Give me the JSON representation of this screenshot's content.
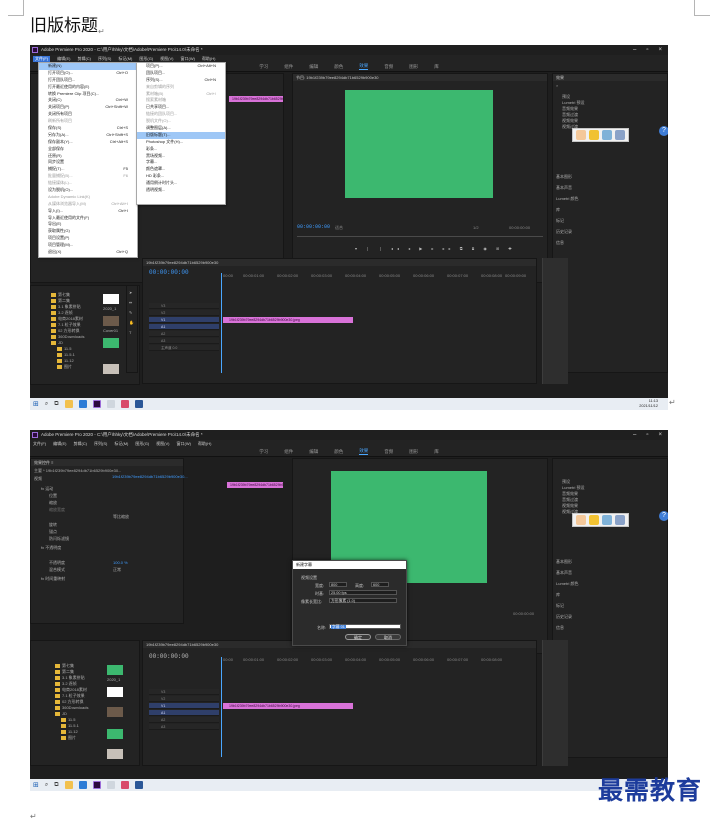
{
  "doc": {
    "title": "旧版标题",
    "return_mark": "↵"
  },
  "app": {
    "window_title": "Adobe Premiere Pro 2020 - C:\\用户\\hhky\\文档\\Adobe\\Premiere Pro\\14.0\\未命名 *",
    "menus": [
      "文件(F)",
      "编辑(E)",
      "剪辑(C)",
      "序列(S)",
      "标记(M)",
      "图形(G)",
      "视图(V)",
      "窗口(W)",
      "帮助(H)"
    ],
    "workspaces": [
      "学习",
      "组件",
      "编辑",
      "颜色",
      "效果",
      "音频",
      "图形",
      "库"
    ],
    "active_workspace": "效果",
    "program_monitor_label": "节目: 19b1f239b79ee8294db71b6529b900e30",
    "source_clip_tab": "19b1f239b79ee8294db71b6529b900e30.jpeg",
    "timeline_tab": "19b1f239b79ee8294db71b6529b900e30",
    "timecode": "00:00:00:00",
    "fit_label": "适合",
    "zoom_ratio": "1/2",
    "sequence_clip": "19b1f239b79ee8294db71b6529b900e30.jpeg",
    "ruler_marks": [
      "00:00",
      "00:00:01:00",
      "00:00:02:00",
      "00:00:03:00",
      "00:00:04:00",
      "00:00:05:00",
      "00:00:06:00",
      "00:00:07:00",
      "00:00:08:00",
      "00:00:09:00"
    ],
    "tracks": [
      "V3",
      "V2",
      "V1",
      "A1",
      "A2",
      "A3",
      "主声道"
    ],
    "master_value": "0.0",
    "effects_panel": {
      "title": "效果",
      "items": [
        "预设",
        "Lumetri 预设",
        "音频效果",
        "音频过渡",
        "视频效果",
        "视频过渡"
      ],
      "sections": [
        "基本图形",
        "基本声音",
        "Lumetri 颜色",
        "库",
        "标记",
        "历史记录",
        "信息"
      ]
    },
    "project_folders": [
      "第七集",
      "第二集",
      "3.1 象素拼贴",
      "3.2 逐帧",
      "(19)",
      "电商2018素材",
      "7.1 粒子效果",
      "02 方形转换",
      "360Downloads",
      "JD",
      "11.5",
      "11.5.1",
      "11.12",
      "图片"
    ],
    "project_thumbs": [
      "2020_1",
      "Cover01",
      "2020_1"
    ],
    "taskbar_time": "11:13",
    "taskbar_date": "2021/11/12"
  },
  "file_menu": {
    "items": [
      {
        "label": "新建(N)",
        "shortcut": "",
        "hl": true
      },
      {
        "label": "打开项目(O)...",
        "shortcut": "Ctrl+O"
      },
      {
        "label": "打开团队项目...",
        "shortcut": ""
      },
      {
        "label": "打开最近使用的内容(E)",
        "shortcut": ""
      },
      {
        "label": "转换 Premiere Clip 项目(C)...",
        "shortcut": ""
      },
      {
        "label": "关闭(C)",
        "shortcut": "Ctrl+W"
      },
      {
        "label": "关闭项目(P)",
        "shortcut": "Ctrl+Shift+W"
      },
      {
        "label": "关闭所有项目",
        "shortcut": ""
      },
      {
        "label": "刷新所有项目",
        "shortcut": "",
        "dim": true
      },
      {
        "label": "保存(S)",
        "shortcut": "Ctrl+S"
      },
      {
        "label": "另存为(A)...",
        "shortcut": "Ctrl+Shift+S"
      },
      {
        "label": "保存副本(Y)...",
        "shortcut": "Ctrl+Alt+S"
      },
      {
        "label": "全部保存",
        "shortcut": ""
      },
      {
        "label": "还原(R)",
        "shortcut": ""
      },
      {
        "label": "同步设置",
        "shortcut": ""
      },
      {
        "label": "捕捉(T)...",
        "shortcut": "F5"
      },
      {
        "label": "批量捕捉(B)...",
        "shortcut": "F6",
        "dim": true
      },
      {
        "label": "链接媒体(L)...",
        "shortcut": "",
        "dim": true
      },
      {
        "label": "设为脱机(O)...",
        "shortcut": ""
      },
      {
        "label": "Adobe Dynamic Link(K)",
        "shortcut": "",
        "dim": true
      },
      {
        "label": "从媒体浏览器导入(M)",
        "shortcut": "Ctrl+Alt+I",
        "dim": true
      },
      {
        "label": "导入(I)...",
        "shortcut": "Ctrl+I"
      },
      {
        "label": "导入最近使用的文件(F)",
        "shortcut": ""
      },
      {
        "label": "导出(E)",
        "shortcut": ""
      },
      {
        "label": "获取属性(G)",
        "shortcut": ""
      },
      {
        "label": "项目设置(P)",
        "shortcut": ""
      },
      {
        "label": "项目管理(M)...",
        "shortcut": ""
      },
      {
        "label": "退出(X)",
        "shortcut": "Ctrl+Q"
      }
    ]
  },
  "new_submenu": {
    "items": [
      {
        "label": "项目(P)...",
        "shortcut": "Ctrl+Alt+N"
      },
      {
        "label": "团队项目...",
        "shortcut": ""
      },
      {
        "label": "序列(S)...",
        "shortcut": "Ctrl+N"
      },
      {
        "label": "来自剪辑的序列",
        "shortcut": "",
        "dim": true
      },
      {
        "label": "素材箱(B)",
        "shortcut": "Ctrl+/",
        "dim": true
      },
      {
        "label": "搜索素材箱",
        "shortcut": "",
        "dim": true
      },
      {
        "label": "已共享项目...",
        "shortcut": ""
      },
      {
        "label": "链接的团队项目...",
        "shortcut": "",
        "dim": true
      },
      {
        "label": "脱机文件(O)...",
        "shortcut": "",
        "dim": true
      },
      {
        "label": "调整图层(A)...",
        "shortcut": ""
      },
      {
        "label": "旧版标题(T)...",
        "shortcut": "",
        "hl": true
      },
      {
        "label": "Photoshop 文件(H)...",
        "shortcut": ""
      },
      {
        "label": "彩条...",
        "shortcut": ""
      },
      {
        "label": "黑场视频...",
        "shortcut": ""
      },
      {
        "label": "字幕...",
        "shortcut": ""
      },
      {
        "label": "颜色遮罩...",
        "shortcut": ""
      },
      {
        "label": "HD 彩条...",
        "shortcut": ""
      },
      {
        "label": "通用倒计时片头...",
        "shortcut": ""
      },
      {
        "label": "透明视频...",
        "shortcut": ""
      }
    ]
  },
  "effect_controls": {
    "tab": "效果控件 ≡",
    "source_label": "主要 * 19b1f239b79ee8294db71b6529b900e30...",
    "sequence_label": "19b1f239b79ee8294db71b6529b900e30...",
    "clip_label": "19b1f239b79ee8294db71b6529b900e30.jpeg",
    "rows": [
      "视频",
      "fx 运动",
      "位置",
      "缩放",
      "缩放宽度",
      "旋转",
      "锚点",
      "防闪烁滤镜",
      "fx 不透明度",
      "fx 时间重映射",
      "不透明度",
      "混合模式"
    ],
    "uniform_scale": "等比缩放",
    "opacity_value": "100.0 %",
    "blend_value": "正常"
  },
  "new_title_dialog": {
    "title": "新建字幕",
    "section": "视频设置",
    "width_label": "宽度:",
    "width": "800",
    "height_label": "高度:",
    "height": "600",
    "timebase_label": "时基:",
    "timebase": "25.00 fps",
    "pixel_aspect_label": "像素长宽比:",
    "pixel_aspect": "方形像素 (1.0)",
    "name_label": "名称:",
    "name_value": "字幕 01",
    "ok": "确定",
    "cancel": "取消"
  },
  "watermark": "最需教育"
}
